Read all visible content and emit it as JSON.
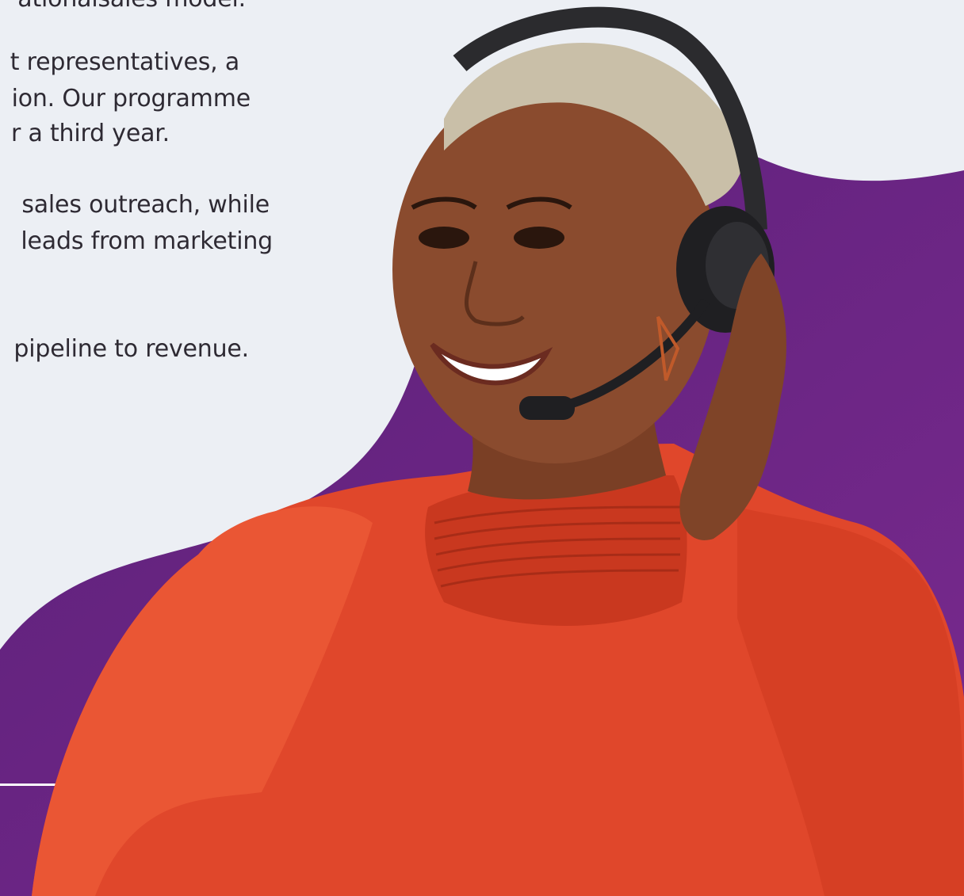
{
  "text": {
    "lines": [
      "ationalsales model.",
      "t representatives, a",
      "ion. Our programme",
      "r a third year.",
      "sales outreach, while",
      "leads from marketing",
      "pipeline to revenue."
    ]
  },
  "colors": {
    "background": "#eceff4",
    "purple": "#6f2a8c",
    "purple_dark": "#5a2078",
    "blouse": "#e0472b",
    "skin": "#8a4b2e",
    "divider": "#ffffff",
    "text": "#2e2a33"
  }
}
